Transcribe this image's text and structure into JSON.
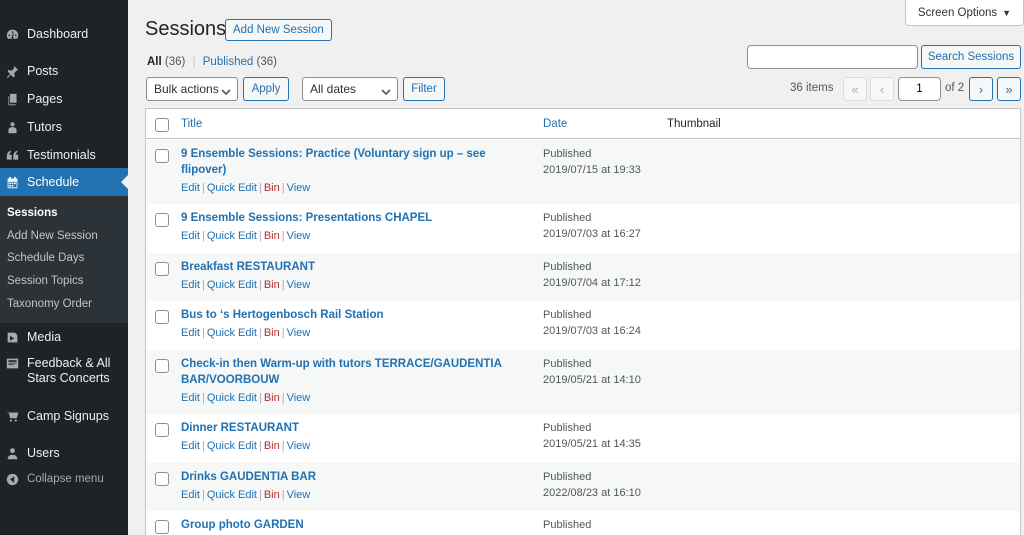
{
  "sidebar": {
    "items": [
      {
        "label": "Dashboard",
        "icon": "dashboard-icon"
      },
      {
        "label": "Posts",
        "icon": "pin-icon"
      },
      {
        "label": "Pages",
        "icon": "pages-icon"
      },
      {
        "label": "Tutors",
        "icon": "users-group-icon"
      },
      {
        "label": "Testimonials",
        "icon": "quote-icon"
      },
      {
        "label": "Schedule",
        "icon": "calendar-icon"
      },
      {
        "label": "Media",
        "icon": "media-icon"
      },
      {
        "label": "Feedback & All Stars Concerts",
        "icon": "feedback-icon"
      },
      {
        "label": "Camp Signups",
        "icon": "cart-icon"
      },
      {
        "label": "Users",
        "icon": "user-icon"
      },
      {
        "label": "Collapse menu",
        "icon": "collapse-icon"
      }
    ],
    "submenu": [
      "Sessions",
      "Add New Session",
      "Schedule Days",
      "Session Topics",
      "Taxonomy Order"
    ]
  },
  "header": {
    "screen_options": "Screen Options",
    "title": "Sessions",
    "add_new": "Add New Session"
  },
  "filters": {
    "all": "All",
    "all_count": "(36)",
    "separator": "|",
    "published": "Published",
    "published_count": "(36)"
  },
  "search": {
    "placeholder": "",
    "button": "Search Sessions"
  },
  "toolbar": {
    "bulk_actions": "Bulk actions",
    "apply": "Apply",
    "all_dates": "All dates",
    "filter": "Filter"
  },
  "pagination": {
    "items": "36 items",
    "first": "«",
    "prev": "‹",
    "current": "1",
    "of": "of 2",
    "next": "›",
    "last": "»"
  },
  "table": {
    "columns": {
      "title": "Title",
      "date": "Date",
      "thumbnail": "Thumbnail"
    },
    "actions": {
      "edit": "Edit",
      "quick_edit": "Quick Edit",
      "bin": "Bin",
      "view": "View",
      "sep": "|"
    },
    "rows": [
      {
        "title_line1": "9 Ensemble Sessions: Practice (Voluntary sign up – see",
        "title_line2": "flipover)",
        "status": "Published",
        "date": "2019/07/15 at 19:33"
      },
      {
        "title_line1": "9 Ensemble Sessions: Presentations CHAPEL",
        "title_line2": "",
        "status": "Published",
        "date": "2019/07/03 at 16:27"
      },
      {
        "title_line1": "Breakfast RESTAURANT",
        "title_line2": "",
        "status": "Published",
        "date": "2019/07/04 at 17:12"
      },
      {
        "title_line1": "Bus to ‘s Hertogenbosch Rail Station",
        "title_line2": "",
        "status": "Published",
        "date": "2019/07/03 at 16:24"
      },
      {
        "title_line1": "Check-in then Warm-up with tutors TERRACE/GAUDENTIA",
        "title_line2": "BAR/VOORBOUW",
        "status": "Published",
        "date": "2019/05/21 at 14:10"
      },
      {
        "title_line1": "Dinner RESTAURANT",
        "title_line2": "",
        "status": "Published",
        "date": "2019/05/21 at 14:35"
      },
      {
        "title_line1": "Drinks GAUDENTIA BAR",
        "title_line2": "",
        "status": "Published",
        "date": "2022/08/23 at 16:10"
      },
      {
        "title_line1": "Group photo GARDEN",
        "title_line2": "",
        "status": "Published",
        "date": ""
      }
    ]
  }
}
